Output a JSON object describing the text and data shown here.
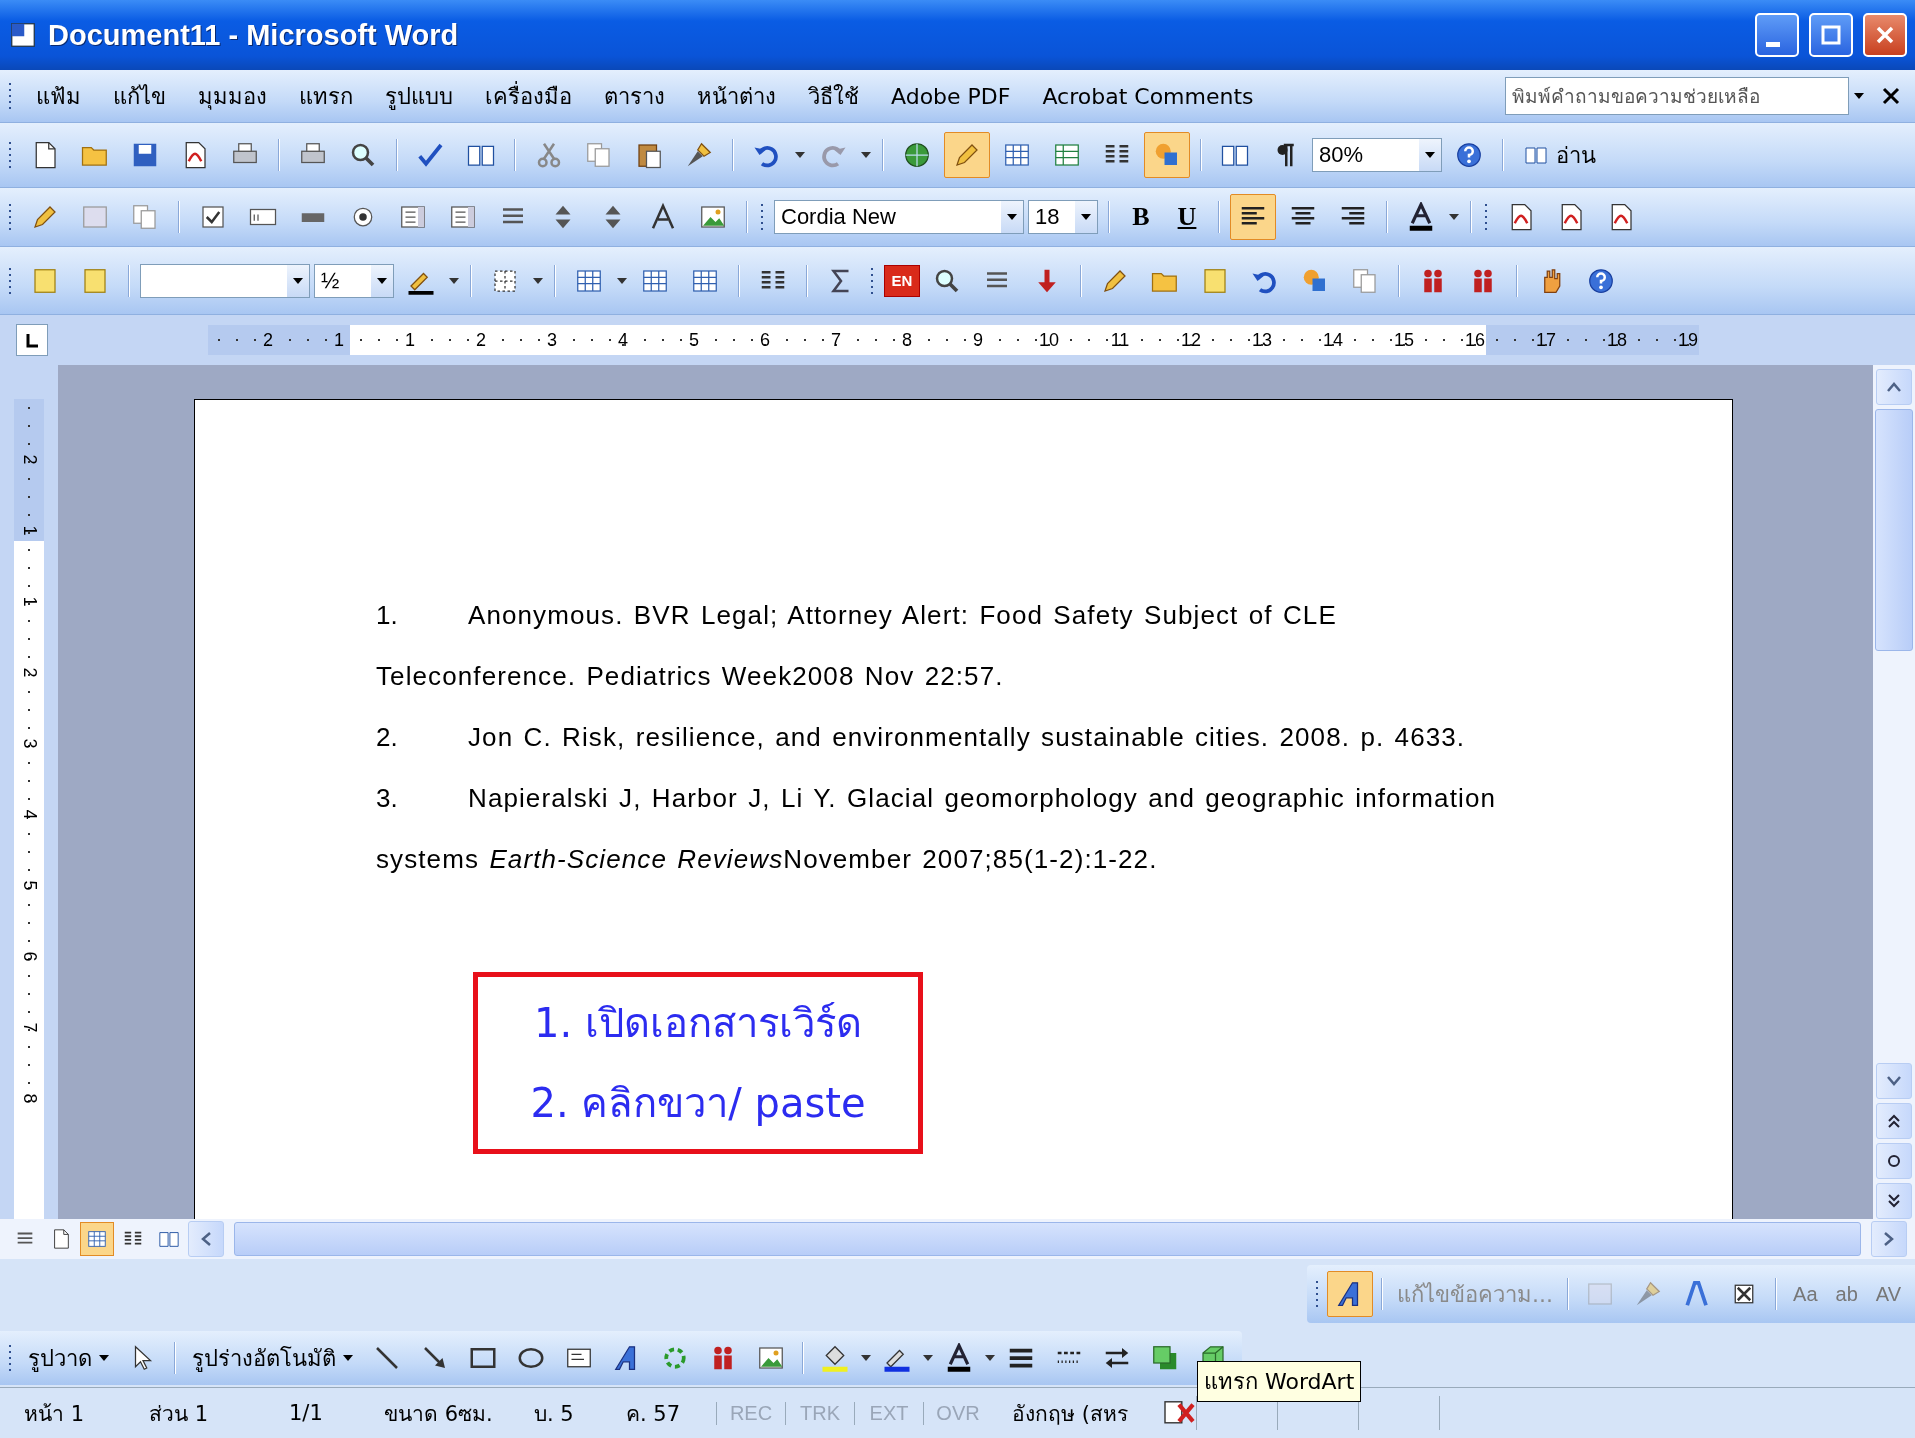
{
  "window": {
    "title": "Document11 - Microsoft Word"
  },
  "menu_bar": {
    "items": [
      "แฟ้ม",
      "แก้ไข",
      "มุมมอง",
      "แทรก",
      "รูปแบบ",
      "เครื่องมือ",
      "ตาราง",
      "หน้าต่าง",
      "วิธีใช้",
      "Adobe PDF",
      "Acrobat Comments"
    ],
    "help_box": {
      "placeholder": "พิมพ์คำถามขอความช่วยเหลือ"
    }
  },
  "standard_toolbar": {
    "tables_and_borders_on": true,
    "drawing_on": true,
    "zoom": "80%",
    "read_button": "อ่าน"
  },
  "formatting_toolbar": {
    "font": "Cordia New",
    "size": "18",
    "bold_label": "B",
    "underline_label": "U",
    "alignment": [
      {
        "selected": true
      },
      {
        "selected": false
      },
      {
        "selected": false
      }
    ]
  },
  "tables_toolbar": {
    "line_weight": "½",
    "language_badge": "EN"
  },
  "ruler": {
    "left_labels": [
      "2",
      "1"
    ],
    "labels": [
      "1",
      "2",
      "3",
      "4",
      "5",
      "6",
      "7",
      "8",
      "9",
      "10",
      "11",
      "12",
      "13",
      "14",
      "15",
      "16",
      "17",
      "18",
      "19"
    ]
  },
  "vertical_ruler": {
    "top_labels": [
      "2",
      "1"
    ],
    "labels": [
      "1",
      "2",
      "3",
      "4",
      "5",
      "6",
      "7",
      "8"
    ]
  },
  "document": {
    "references": [
      {
        "number": "1.",
        "text": "Anonymous. BVR Legal; Attorney Alert: Food Safety Subject of CLE",
        "continuation": [
          {
            "text": "Teleconference. Pediatrics Week2008 Nov 22:57.",
            "italic": false
          }
        ]
      },
      {
        "number": "2.",
        "text": "Jon C. Risk, resilience, and environmentally sustainable cities. 2008. p. 4633."
      },
      {
        "number": "3.",
        "text": "Napieralski J, Harbor J, Li Y. Glacial geomorphology and geographic information",
        "continuation": [
          {
            "text": "systems ",
            "italic": false
          },
          {
            "text": "Earth-Science Reviews",
            "italic": true
          },
          {
            "text": "November 2007;85(1-2):1-22.",
            "italic": false
          }
        ]
      }
    ],
    "callout": [
      "1. เปิดเอกสารเวิร์ด",
      "2. คลิกขวา/ paste"
    ]
  },
  "view_buttons": [
    {
      "selected": false
    },
    {
      "selected": false
    },
    {
      "selected": true
    },
    {
      "selected": false
    },
    {
      "selected": false
    }
  ],
  "wordart_toolbar": {
    "insert_selected": true,
    "edit_text": "แก้ไขข้อความ...",
    "glyphs": [
      "Aa",
      "ab",
      "AV"
    ]
  },
  "drawing_toolbar": {
    "draw_menu": "รูปวาด",
    "autoshapes": "รูปร่างอัตโนมัติ"
  },
  "tooltip": "แทรก WordArt",
  "status_bar": {
    "fields": [
      "หน้า 1",
      "ส่วน 1",
      "1/1",
      "ขนาด 6ซม.",
      "บ. 5",
      "ค. 57"
    ],
    "modes": [
      {
        "label": "REC",
        "disabled": true
      },
      {
        "label": "TRK",
        "disabled": true
      },
      {
        "label": "EXT",
        "disabled": true
      },
      {
        "label": "OVR",
        "disabled": true
      }
    ],
    "language": "อังกฤษ (สหร"
  }
}
